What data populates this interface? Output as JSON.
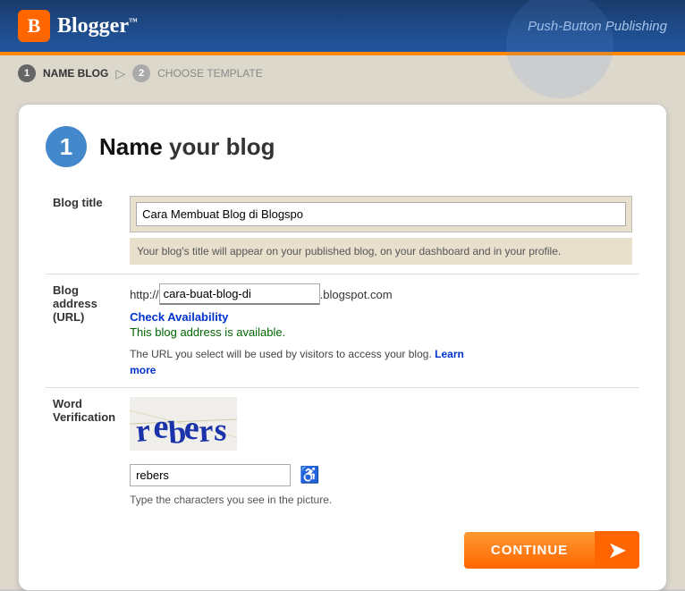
{
  "header": {
    "logo_letter": "B",
    "brand_name": "Blogger",
    "tm": "™",
    "tagline": "Push-Button Publishing"
  },
  "breadcrumb": {
    "step1_number": "1",
    "step1_label": "NAME BLOG",
    "step2_number": "2",
    "step2_label": "CHOOSE TEMPLATE",
    "arrow": "▷"
  },
  "form": {
    "step_number": "1",
    "step_title_bold": "Name",
    "step_title_rest": " your blog",
    "blog_title_label": "Blog title",
    "blog_title_value": "Cara Membuat Blog di Blogspo",
    "blog_title_hint": "Your blog's title will appear on your published blog, on your dashboard and in your profile.",
    "url_label": "Blog address (URL)",
    "url_prefix": "http://",
    "url_value": "cara-buat-blog-di",
    "url_suffix": ".blogspot.com",
    "check_link": "Check Availability",
    "available_msg": "This blog address is available.",
    "url_hint_prefix": "The URL you select will be used by visitors to access your blog.",
    "learn_link": "Learn",
    "more_link": "more",
    "word_verification_label": "Word Verification",
    "captcha_text": "rebers",
    "captcha_input_value": "rebers",
    "captcha_hint": "Type the characters you see in the picture.",
    "continue_label": "CONTINUE",
    "arrow_symbol": "➤"
  }
}
